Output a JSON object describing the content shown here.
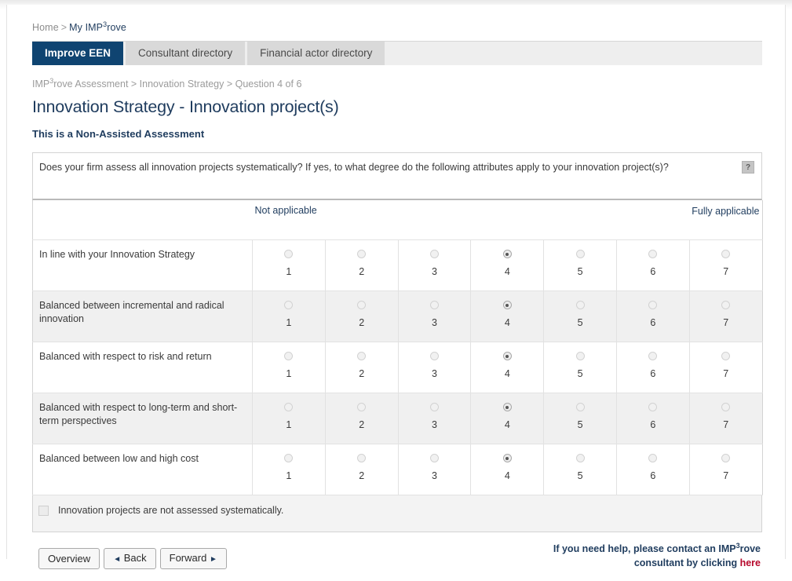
{
  "breadcrumb_top": {
    "items": [
      {
        "label": "Home",
        "current": false
      },
      {
        "label": "My IMP³rove",
        "current": true
      }
    ],
    "separator": ">"
  },
  "tabs": [
    {
      "label": "Improve EEN",
      "active": true
    },
    {
      "label": "Consultant directory",
      "active": false
    },
    {
      "label": "Financial actor directory",
      "active": false
    }
  ],
  "breadcrumb_inner": {
    "text": "IMP³rove Assessment > Innovation Strategy > Question 4 of 6"
  },
  "page_title": "Innovation Strategy - Innovation project(s)",
  "assessment_notice": "This is a Non-Assisted Assessment",
  "question": {
    "text": "Does your firm assess all innovation projects systematically? If yes, to what degree do the following attributes apply to your innovation project(s)?",
    "help_label": "?"
  },
  "matrix": {
    "scale_low_label": "Not applicable",
    "scale_high_label": "Fully applicable",
    "scale_values": [
      "1",
      "2",
      "3",
      "4",
      "5",
      "6",
      "7"
    ],
    "rows": [
      {
        "label": "In line with your Innovation Strategy",
        "selected": 4
      },
      {
        "label": "Balanced between incremental and radical innovation",
        "selected": 4
      },
      {
        "label": "Balanced with respect to risk and return",
        "selected": 4
      },
      {
        "label": "Balanced with respect to long-term and short-term perspectives",
        "selected": 4
      },
      {
        "label": "Balanced between low and high cost",
        "selected": 4
      }
    ]
  },
  "optout": {
    "label": "Innovation projects are not assessed systematically.",
    "checked": false
  },
  "footer": {
    "buttons": [
      {
        "label": "Overview",
        "arrow": "none"
      },
      {
        "label": "Back",
        "arrow": "left",
        "glyph": "◄"
      },
      {
        "label": "Forward",
        "arrow": "right",
        "glyph": "►"
      }
    ],
    "help_line1": "If you need help, please contact an IMP³rove",
    "help_line2_prefix": "consultant by clicking ",
    "help_link": "here"
  },
  "colors": {
    "brand_navy": "#0f4471",
    "heading_navy": "#1f3c5e",
    "link_red": "#b6072b",
    "tab_inactive": "#d9d9d9",
    "row_alt": "#f0f0f0"
  }
}
